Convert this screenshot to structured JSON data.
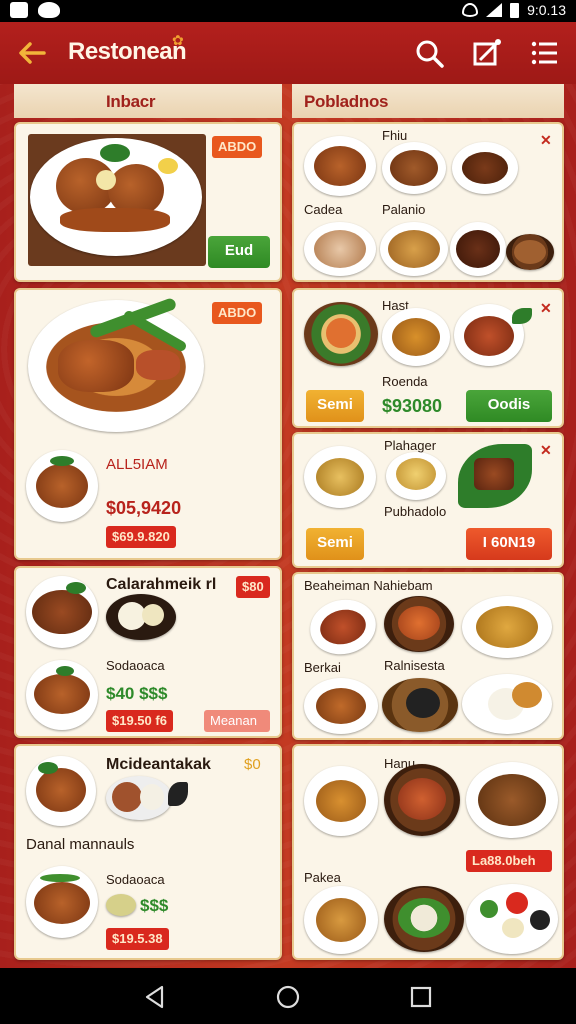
{
  "status_bar": {
    "time": "9:0.13"
  },
  "app_bar": {
    "title": "Restonean"
  },
  "columns": {
    "left": "Inbacr",
    "right": "Pobladnos"
  },
  "left": {
    "card1": {
      "badge": "ABDO",
      "button": "Eud"
    },
    "card2": {
      "badge": "ABDO",
      "name": "ALL5IAM",
      "price": "$05,9420",
      "tag": "$69.9.820"
    },
    "card3": {
      "name": "Calarahmeik rl",
      "badge": "$80",
      "sub": "Sodaoaca",
      "price": "$40 $$$",
      "tag": "$19.50 f6",
      "tag2": "Meanan"
    },
    "card4": {
      "name": "Mcideantakak",
      "badge": "$0",
      "section": "Danal mannauls",
      "sub": "Sodaoaca",
      "price": "$$$",
      "tag": "$19.5.38"
    }
  },
  "right": {
    "card1": {
      "label_top": "Fhiu",
      "label_a": "Cadea",
      "label_b": "Palanio"
    },
    "card2": {
      "label_top": "Hast",
      "label_mid": "Roenda",
      "button_left": "Semi",
      "price": "$93080",
      "button_right": "Oodis"
    },
    "card3": {
      "label_top": "Plahager",
      "label_mid": "Pubhadolo",
      "button_left": "Semi",
      "button_right": "I 60N19"
    },
    "card4": {
      "label_top": "Beaheiman Nahiebam",
      "label_a": "Berkai",
      "label_b": "Ralnisesta"
    },
    "card5": {
      "label_top": "Hanu",
      "label_a": "Pakea",
      "tag": "La88.0beh"
    }
  },
  "colors": {
    "brand": "#a8201c",
    "accent_green": "#2f8a24",
    "cream": "#fbf5e8"
  }
}
